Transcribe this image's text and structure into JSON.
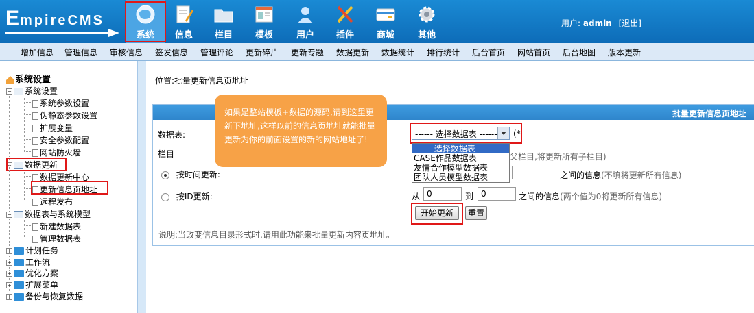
{
  "logo": {
    "first": "E",
    "rest": "mpireCMS"
  },
  "nav": [
    {
      "label": "系统",
      "icon": "globe-icon",
      "active": true
    },
    {
      "label": "信息",
      "icon": "edit-icon"
    },
    {
      "label": "栏目",
      "icon": "folder-icon"
    },
    {
      "label": "模板",
      "icon": "template-icon"
    },
    {
      "label": "用户",
      "icon": "user-icon"
    },
    {
      "label": "插件",
      "icon": "tools-icon"
    },
    {
      "label": "商城",
      "icon": "card-icon"
    },
    {
      "label": "其他",
      "icon": "gear-icon"
    }
  ],
  "user": {
    "prefix": "用户:",
    "name": "admin",
    "logout": "[退出]"
  },
  "submenu": [
    "增加信息",
    "管理信息",
    "审核信息",
    "签发信息",
    "管理评论",
    "更新碎片",
    "更新专题",
    "数据更新",
    "数据统计",
    "排行统计",
    "后台首页",
    "网站首页",
    "后台地图",
    "版本更新"
  ],
  "tree": {
    "root": "系统设置",
    "n0": "系统设置",
    "n0_children": [
      "系统参数设置",
      "伪静态参数设置",
      "扩展变量",
      "安全参数配置",
      "网站防火墙"
    ],
    "n1": "数据更新",
    "n1_children": [
      "数据更新中心",
      "更新信息页地址",
      "远程发布"
    ],
    "n2": "数据表与系统模型",
    "n2_children": [
      "新建数据表",
      "管理数据表"
    ],
    "folders": [
      "计划任务",
      "工作流",
      "优化方案",
      "扩展菜单",
      "备份与恢复数据"
    ]
  },
  "main": {
    "breadcrumb": "位置:批量更新信息页地址",
    "panel_title": "批量更新信息页地址",
    "table_label": "数据表:",
    "table_select": "------ 选择数据表 ------",
    "required_mark": "(*",
    "column_label": "栏目",
    "column_hint": "父栏目,将更新所有子栏目)",
    "time_update_label": "按时间更新:",
    "time_hint_main": "之间的信息",
    "time_hint_gray": "(不填将更新所有信息)",
    "id_update_label": "按ID更新:",
    "from_label": "从",
    "from_value": "0",
    "to_label": "到",
    "to_value": "0",
    "id_hint_main": "之间的信息",
    "id_hint_gray": "(两个值为0将更新所有信息)",
    "start_button": "开始更新",
    "reset_button": "重置",
    "note": "说明:当改变信息目录形式时,请用此功能来批量更新内容页地址。",
    "dropdown_options": [
      "------ 选择数据表 ------",
      "CASE作品数据表",
      "友情合作模型数据表",
      "团队人员模型数据表"
    ],
    "callout": "如果是整站模板+数据的源码,请到这里更新下地址,这样以前的信息页地址就能批量更新为你的前面设置的新的网站地址了!"
  },
  "colors": {
    "header": "#1a8ad4",
    "annotation": "#e01818",
    "callout": "#f7a247",
    "dropdown_selected": "#316ac5"
  }
}
